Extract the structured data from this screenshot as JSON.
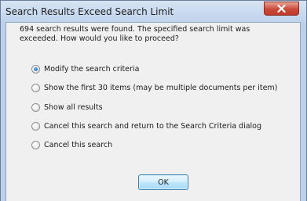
{
  "dialog": {
    "title": "Search Results Exceed Search Limit",
    "message": "694 search results were found. The specified search limit was exceeded. How would you like to proceed?",
    "options": [
      {
        "label": "Modify the search criteria",
        "selected": true
      },
      {
        "label": "Show the first 30 items (may be multiple documents per item)",
        "selected": false
      },
      {
        "label": "Show all results",
        "selected": false
      },
      {
        "label": "Cancel this search and return to the Search Criteria dialog",
        "selected": false
      },
      {
        "label": "Cancel this search",
        "selected": false
      }
    ],
    "ok_label": "OK"
  },
  "icons": {
    "close": "close-icon"
  },
  "colors": {
    "frame": "#bcd0ea",
    "client": "#f0f0f0",
    "close_button": "#c9493a"
  }
}
